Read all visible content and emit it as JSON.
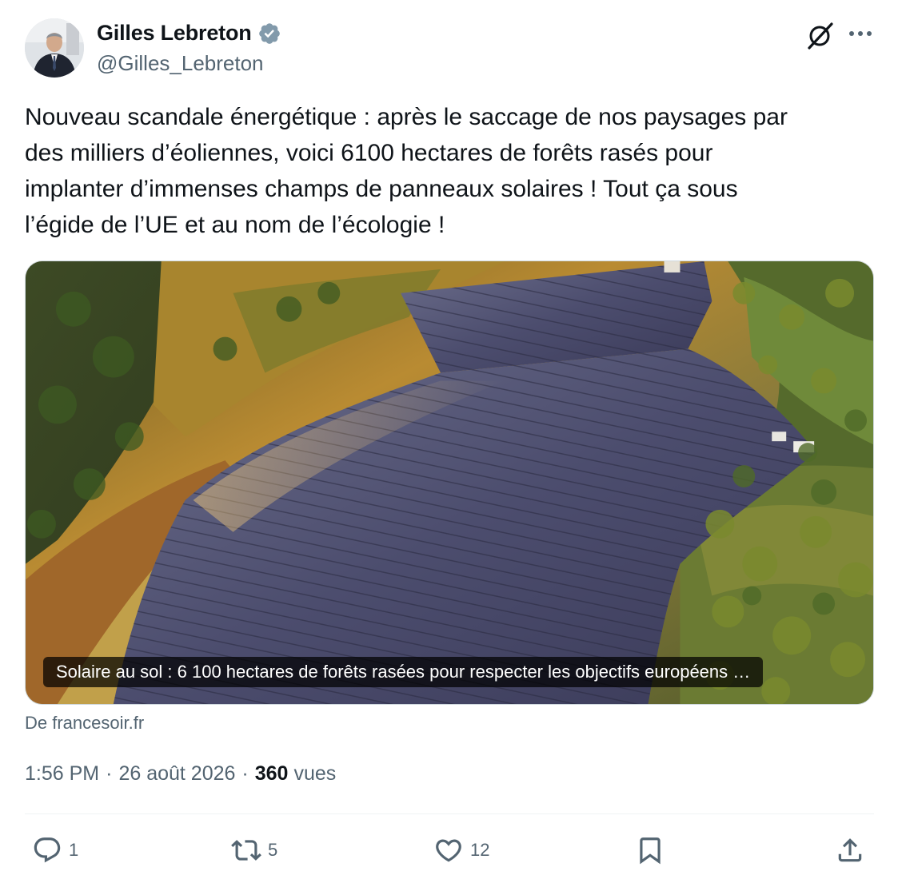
{
  "author": {
    "display_name": "Gilles Lebreton",
    "handle": "@Gilles_Lebreton",
    "verified": true
  },
  "tweet": {
    "text": "Nouveau scandale énergétique : après le saccage de nos paysages par\ndes milliers d’éoliennes, voici 6100 hectares de forêts rasés pour\nimplanter d’immenses champs de panneaux solaires ! Tout ça sous\nl’égide de l’UE et au nom de l’écologie !"
  },
  "link_card": {
    "caption": "Solaire au sol : 6 100 hectares de forêts rasées pour respecter les objectifs européens …",
    "source": "De francesoir.fr"
  },
  "meta": {
    "time": "1:56 PM",
    "date": "26 août 2026",
    "separator": "·",
    "views_count": "360",
    "views_label": "vues"
  },
  "actions": {
    "replies": "1",
    "reposts": "5",
    "likes": "12"
  },
  "icons": {
    "verified": "verified-badge-icon",
    "grok": "grok-icon",
    "more": "more-icon",
    "reply": "reply-icon",
    "repost": "repost-icon",
    "like": "heart-icon",
    "bookmark": "bookmark-icon",
    "share": "share-icon"
  },
  "colors": {
    "text_primary": "#0f1419",
    "text_secondary": "#536471",
    "verified_badge": "#829aab",
    "border": "#cfd9de"
  }
}
